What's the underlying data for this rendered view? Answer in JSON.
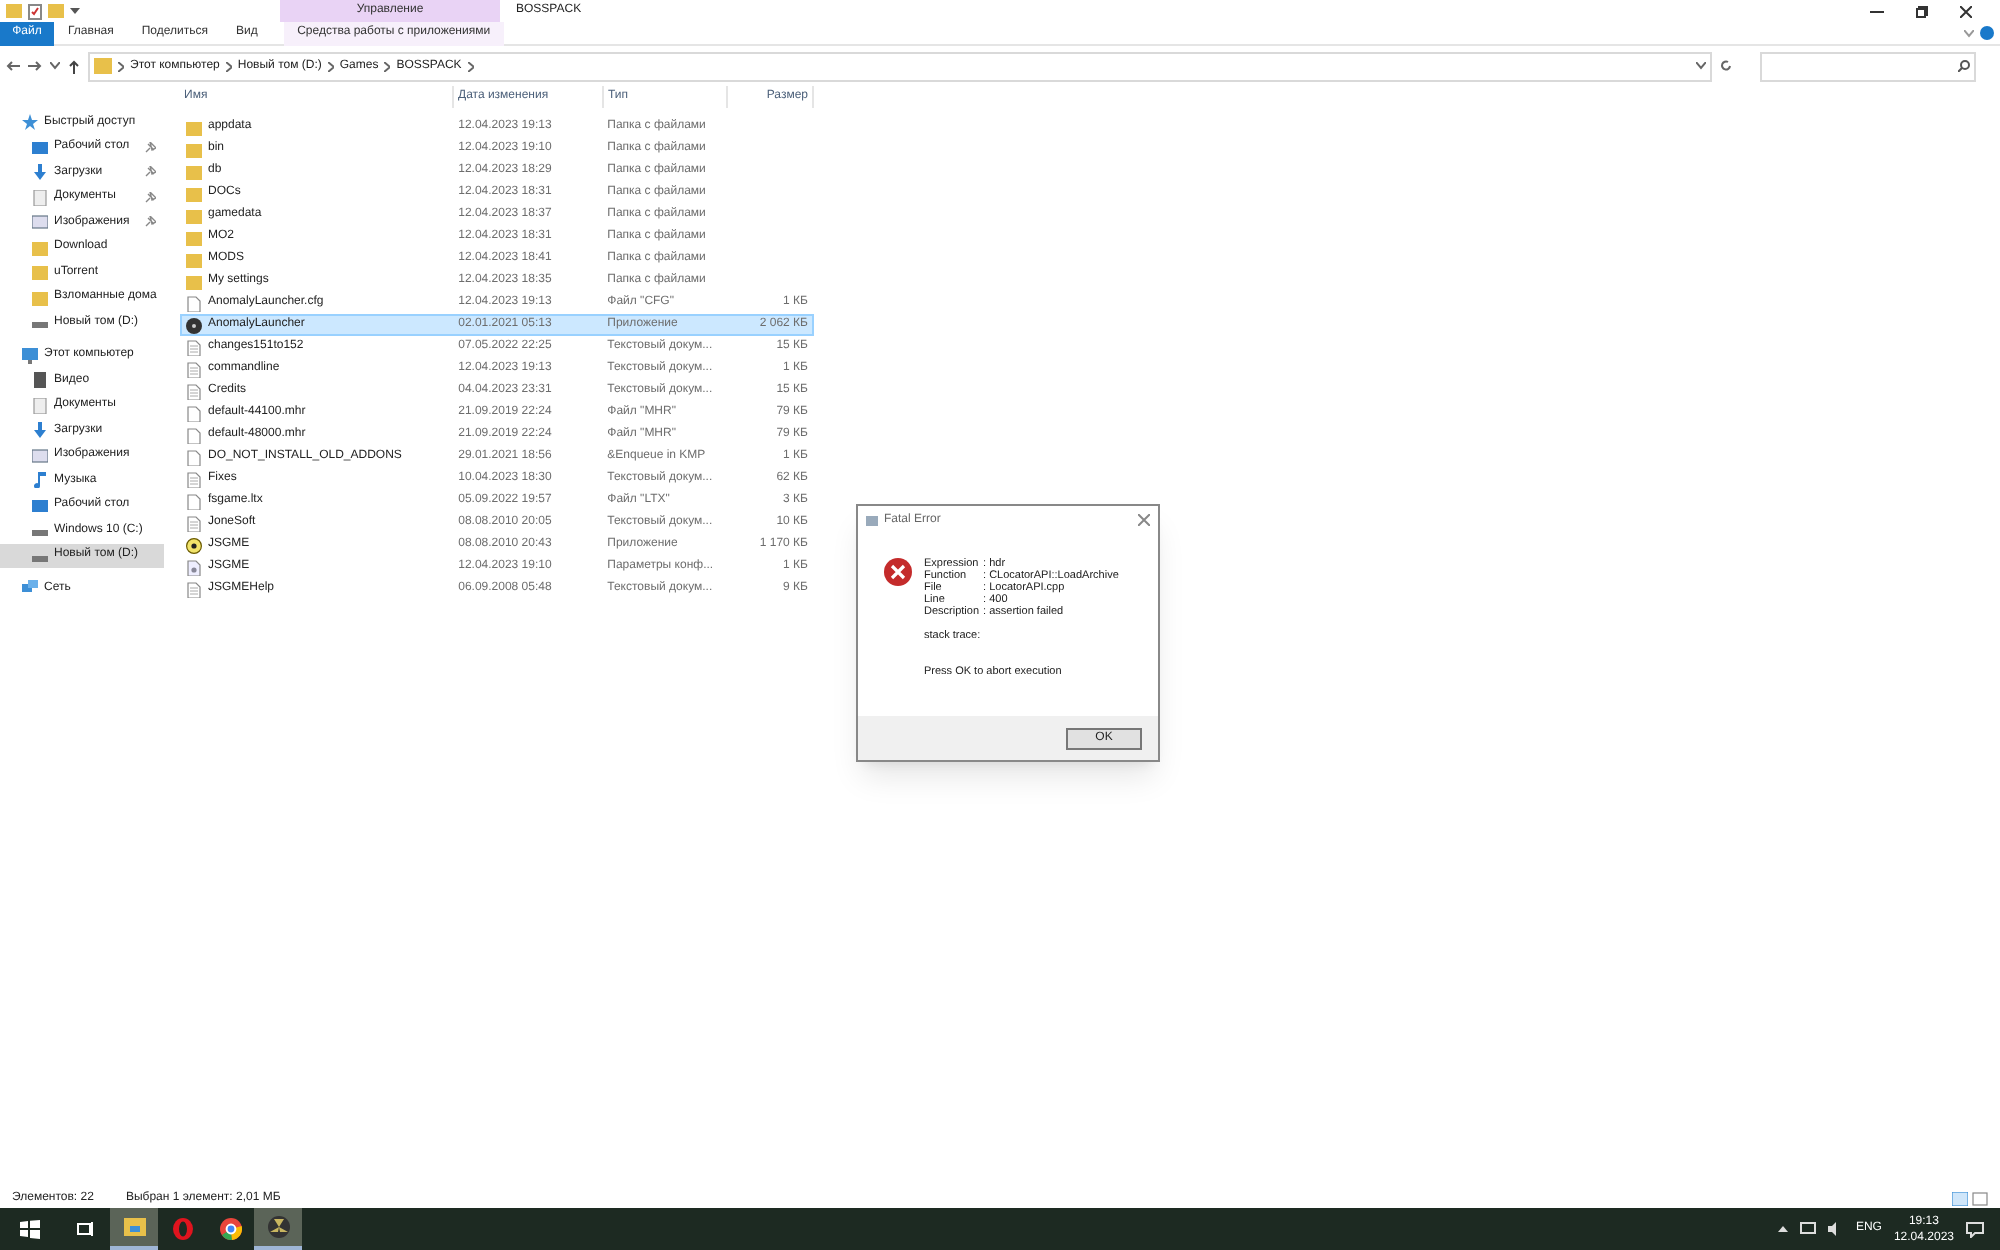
{
  "title_bar": {
    "context_tab": "Управление",
    "title": "BOSSPACK"
  },
  "ribbon_tabs": [
    {
      "label": "Файл",
      "selected": true,
      "kind": "file"
    },
    {
      "label": "Главная",
      "selected": false,
      "kind": "normal"
    },
    {
      "label": "Поделиться",
      "selected": false,
      "kind": "normal"
    },
    {
      "label": "Вид",
      "selected": false,
      "kind": "normal"
    },
    {
      "label": "Средства работы с приложениями",
      "selected": false,
      "kind": "context"
    }
  ],
  "breadcrumb": [
    "Этот компьютер",
    "Новый том (D:)",
    "Games",
    "BOSSPACK"
  ],
  "nav": [
    {
      "label": "Быстрый доступ",
      "kind": "star",
      "selected": false,
      "children": [
        {
          "label": "Рабочий стол",
          "kind": "desktop",
          "pinned": true,
          "selected": false
        },
        {
          "label": "Загрузки",
          "kind": "download",
          "pinned": true,
          "selected": false
        },
        {
          "label": "Документы",
          "kind": "docs",
          "pinned": true,
          "selected": false
        },
        {
          "label": "Изображения",
          "kind": "pictures",
          "pinned": true,
          "selected": false
        },
        {
          "label": "Download",
          "kind": "folder",
          "pinned": false,
          "selected": false
        },
        {
          "label": "uTorrent",
          "kind": "folder",
          "pinned": false,
          "selected": false
        },
        {
          "label": "Взломанные дома",
          "kind": "folder",
          "pinned": false,
          "selected": false
        },
        {
          "label": "Новый том (D:)",
          "kind": "drive",
          "pinned": false,
          "selected": false
        }
      ]
    },
    {
      "label": "Этот компьютер",
      "kind": "pc",
      "selected": false,
      "children": [
        {
          "label": "Видео",
          "kind": "video",
          "pinned": false,
          "selected": false
        },
        {
          "label": "Документы",
          "kind": "docs",
          "pinned": false,
          "selected": false
        },
        {
          "label": "Загрузки",
          "kind": "download",
          "pinned": false,
          "selected": false
        },
        {
          "label": "Изображения",
          "kind": "pictures",
          "pinned": false,
          "selected": false
        },
        {
          "label": "Музыка",
          "kind": "music",
          "pinned": false,
          "selected": false
        },
        {
          "label": "Рабочий стол",
          "kind": "desktop",
          "pinned": false,
          "selected": false
        },
        {
          "label": "Windows 10 (C:)",
          "kind": "drive",
          "pinned": false,
          "selected": false
        },
        {
          "label": "Новый том (D:)",
          "kind": "drive",
          "pinned": false,
          "selected": true
        }
      ]
    },
    {
      "label": "Сеть",
      "kind": "network",
      "selected": false
    }
  ],
  "table": {
    "columns": [
      "Имя",
      "Дата изменения",
      "Тип",
      "Размер"
    ],
    "rows": [
      {
        "name": "appdata",
        "date": "12.04.2023 19:13",
        "type": "Папка с файлами",
        "size": "",
        "kind": "folder",
        "selected": false
      },
      {
        "name": "bin",
        "date": "12.04.2023 19:10",
        "type": "Папка с файлами",
        "size": "",
        "kind": "folder",
        "selected": false
      },
      {
        "name": "db",
        "date": "12.04.2023 18:29",
        "type": "Папка с файлами",
        "size": "",
        "kind": "folder",
        "selected": false
      },
      {
        "name": "DOCs",
        "date": "12.04.2023 18:31",
        "type": "Папка с файлами",
        "size": "",
        "kind": "folder",
        "selected": false
      },
      {
        "name": "gamedata",
        "date": "12.04.2023 18:37",
        "type": "Папка с файлами",
        "size": "",
        "kind": "folder",
        "selected": false
      },
      {
        "name": "MO2",
        "date": "12.04.2023 18:31",
        "type": "Папка с файлами",
        "size": "",
        "kind": "folder",
        "selected": false
      },
      {
        "name": "MODS",
        "date": "12.04.2023 18:41",
        "type": "Папка с файлами",
        "size": "",
        "kind": "folder",
        "selected": false
      },
      {
        "name": "My settings",
        "date": "12.04.2023 18:35",
        "type": "Папка с файлами",
        "size": "",
        "kind": "folder",
        "selected": false
      },
      {
        "name": "AnomalyLauncher.cfg",
        "date": "12.04.2023 19:13",
        "type": "Файл \"CFG\"",
        "size": "1 КБ",
        "kind": "blank",
        "selected": false
      },
      {
        "name": "AnomalyLauncher",
        "date": "02.01.2021 05:13",
        "type": "Приложение",
        "size": "2 062 КБ",
        "kind": "radiation",
        "selected": true
      },
      {
        "name": "changes151to152",
        "date": "07.05.2022 22:25",
        "type": "Текстовый докум...",
        "size": "15 КБ",
        "kind": "text",
        "selected": false
      },
      {
        "name": "commandline",
        "date": "12.04.2023 19:13",
        "type": "Текстовый докум...",
        "size": "1 КБ",
        "kind": "text",
        "selected": false
      },
      {
        "name": "Credits",
        "date": "04.04.2023 23:31",
        "type": "Текстовый докум...",
        "size": "15 КБ",
        "kind": "text",
        "selected": false
      },
      {
        "name": "default-44100.mhr",
        "date": "21.09.2019 22:24",
        "type": "Файл \"MHR\"",
        "size": "79 КБ",
        "kind": "blank",
        "selected": false
      },
      {
        "name": "default-48000.mhr",
        "date": "21.09.2019 22:24",
        "type": "Файл \"MHR\"",
        "size": "79 КБ",
        "kind": "blank",
        "selected": false
      },
      {
        "name": "DO_NOT_INSTALL_OLD_ADDONS",
        "date": "29.01.2021 18:56",
        "type": "&Enqueue in KMP",
        "size": "1 КБ",
        "kind": "blank",
        "selected": false
      },
      {
        "name": "Fixes",
        "date": "10.04.2023 18:30",
        "type": "Текстовый докум...",
        "size": "62 КБ",
        "kind": "text",
        "selected": false
      },
      {
        "name": "fsgame.ltx",
        "date": "05.09.2022 19:57",
        "type": "Файл \"LTX\"",
        "size": "3 КБ",
        "kind": "blank",
        "selected": false
      },
      {
        "name": "JoneSoft",
        "date": "08.08.2010 20:05",
        "type": "Текстовый докум...",
        "size": "10 КБ",
        "kind": "text",
        "selected": false
      },
      {
        "name": "JSGME",
        "date": "08.08.2010 20:43",
        "type": "Приложение",
        "size": "1 170 КБ",
        "kind": "app",
        "selected": false
      },
      {
        "name": "JSGME",
        "date": "12.04.2023 19:10",
        "type": "Параметры конф...",
        "size": "1 КБ",
        "kind": "settings",
        "selected": false
      },
      {
        "name": "JSGMEHelp",
        "date": "06.09.2008 05:48",
        "type": "Текстовый докум...",
        "size": "9 КБ",
        "kind": "text",
        "selected": false
      }
    ]
  },
  "status_bar": {
    "count": "Элементов: 22",
    "selection": "Выбран 1 элемент: 2,01 МБ"
  },
  "dialog": {
    "title": "Fatal Error",
    "fields": [
      {
        "label": "Expression",
        "value": ": hdr"
      },
      {
        "label": "Function",
        "value": ": CLocatorAPI::LoadArchive"
      },
      {
        "label": "File",
        "value": ": LocatorAPI.cpp"
      },
      {
        "label": "Line",
        "value": ": 400"
      },
      {
        "label": "Description",
        "value": ": assertion failed"
      }
    ],
    "stack": "stack trace:",
    "message": "Press OK to abort execution",
    "button": "OK"
  },
  "taskbar": {
    "apps": [
      {
        "kind": "explorer",
        "active": true
      },
      {
        "kind": "opera",
        "active": false
      },
      {
        "kind": "chrome",
        "active": false
      },
      {
        "kind": "radiation",
        "active": true
      }
    ],
    "language": "ENG",
    "time": "19:13",
    "date": "12.04.2023"
  }
}
